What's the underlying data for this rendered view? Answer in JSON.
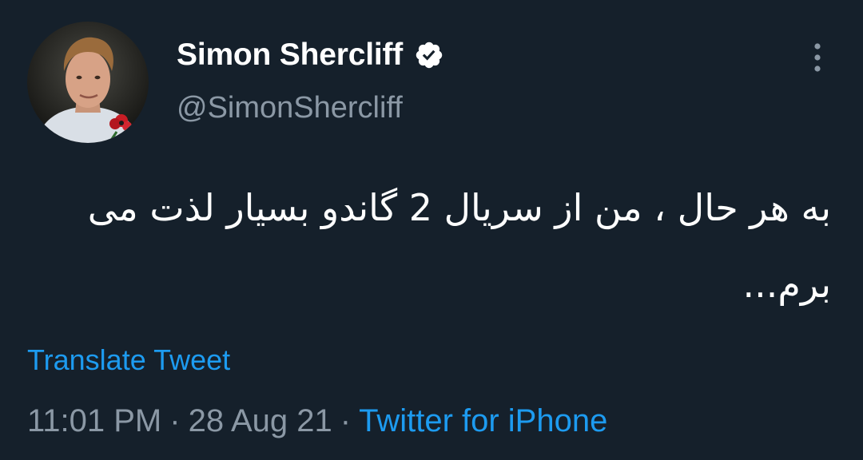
{
  "author": {
    "display_name": "Simon Shercliff",
    "handle": "@SimonShercliff",
    "verified": true,
    "avatar_icon": "profile-photo"
  },
  "tweet": {
    "text": "به هر حال ، من از سریال 2 گاندو بسیار لذت می برم..."
  },
  "actions": {
    "translate_label": "Translate Tweet",
    "more_icon": "vertical-ellipsis-icon"
  },
  "meta": {
    "time": "11:01 PM",
    "separator": "·",
    "date": "28 Aug 21",
    "source": "Twitter for iPhone"
  },
  "colors": {
    "background": "#15202b",
    "text_primary": "#ffffff",
    "text_secondary": "#8b98a5",
    "accent": "#1d9bf0"
  }
}
